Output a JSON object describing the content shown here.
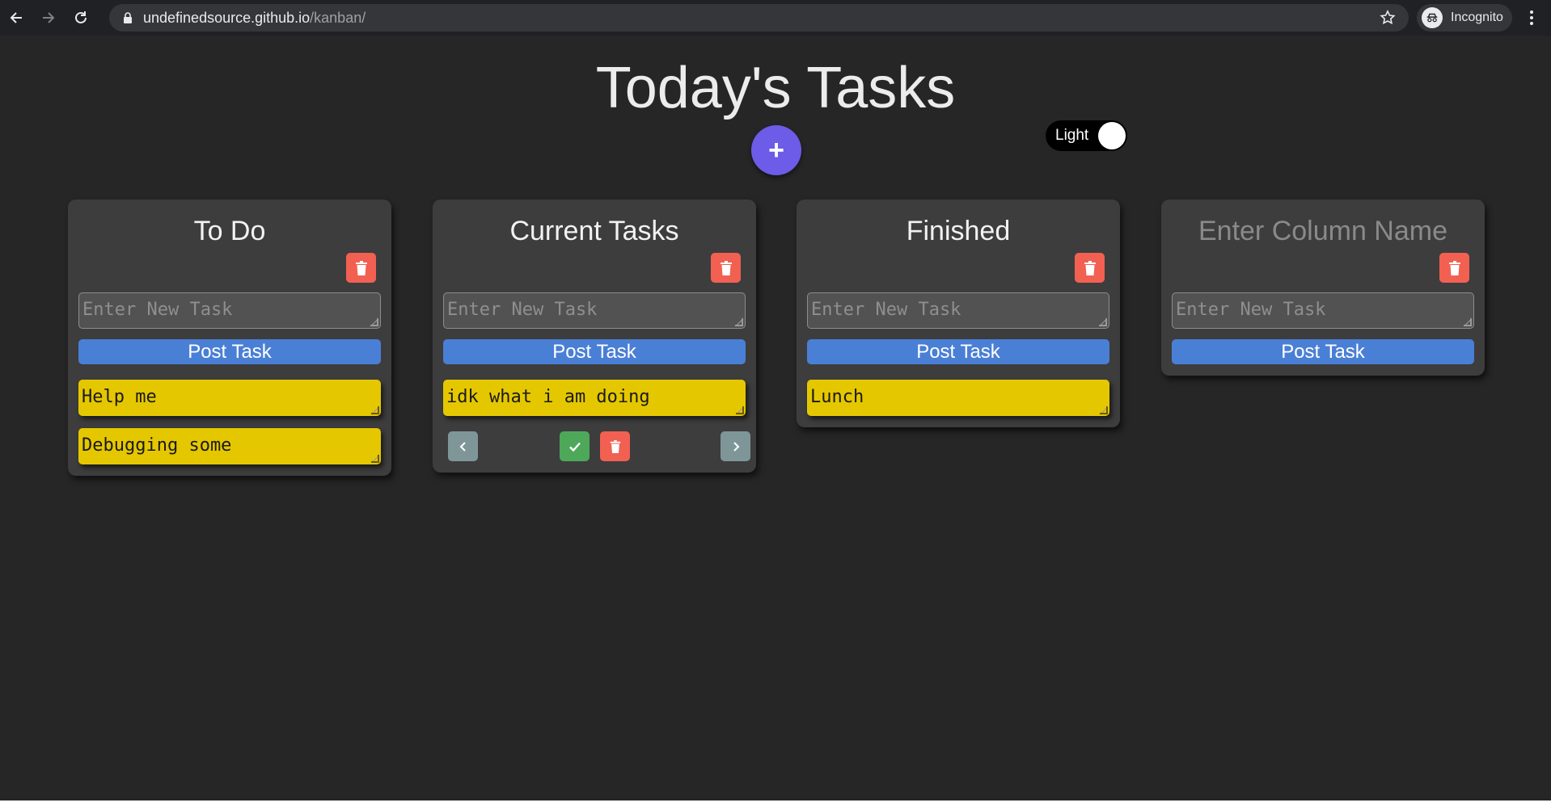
{
  "browser": {
    "url_host": "undefinedsource.github.io",
    "url_path": "/kanban/",
    "profile_label": "Incognito"
  },
  "page": {
    "title": "Today's Tasks",
    "add_column_label": "+",
    "theme_toggle_label": "Light"
  },
  "columns": [
    {
      "title": "To Do",
      "title_is_placeholder": false,
      "new_task_placeholder": "Enter New Task",
      "post_label": "Post Task",
      "tasks": [
        "Help me",
        "Debugging some"
      ]
    },
    {
      "title": "Current Tasks",
      "title_is_placeholder": false,
      "new_task_placeholder": "Enter New Task",
      "post_label": "Post Task",
      "tasks": [
        "idk what i am doing"
      ],
      "selected_task_actions": [
        "chevron-left-icon",
        "check-icon",
        "trash-icon",
        "chevron-right-icon"
      ]
    },
    {
      "title": "Finished",
      "title_is_placeholder": false,
      "new_task_placeholder": "Enter New Task",
      "post_label": "Post Task",
      "tasks": [
        "Lunch"
      ]
    },
    {
      "title": "Enter Column Name",
      "title_is_placeholder": true,
      "new_task_placeholder": "Enter New Task",
      "post_label": "Post Task",
      "tasks": []
    }
  ],
  "colors": {
    "background": "#262626",
    "column": "#3d3d3d",
    "accent_add": "#6c5ce7",
    "post_button": "#4a7fd6",
    "task_card": "#e5c700",
    "delete": "#f26052",
    "done": "#4ea85a",
    "move": "#7f9699"
  }
}
